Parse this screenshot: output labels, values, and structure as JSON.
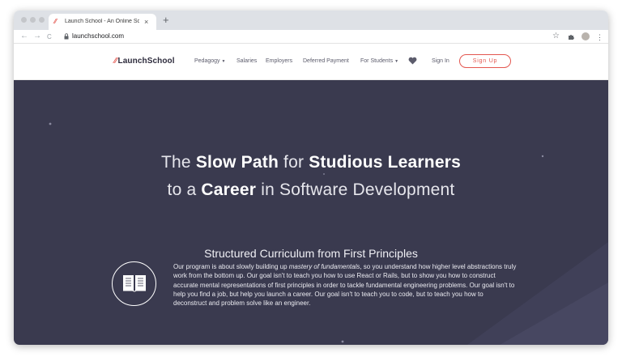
{
  "browser": {
    "tab_title": "Launch School - An Online Sc",
    "tab_close": "×",
    "new_tab": "+",
    "nav": {
      "back": "←",
      "forward": "→",
      "reload": "C"
    },
    "url": "launchschool.com",
    "toolbar_icons": [
      "star-icon",
      "puzzle-icon",
      "avatar",
      "menu-icon"
    ]
  },
  "site": {
    "logo": "LaunchSchool",
    "logo_mark": "⁄⁄",
    "nav": [
      {
        "label": "Pedagogy",
        "has_caret": true
      },
      {
        "label": "Salaries",
        "has_caret": false
      },
      {
        "label": "Employers",
        "has_caret": false
      },
      {
        "label": "Deferred Payment",
        "has_caret": false
      },
      {
        "label": "For Students",
        "has_caret": true
      }
    ],
    "caret": "▼",
    "signin": "Sign In",
    "signup": "Sign Up"
  },
  "hero": {
    "line1": {
      "p1": "The ",
      "b1": "Slow Path",
      "p2": " for ",
      "b2": "Studious Learners"
    },
    "line2": {
      "p1": "to a ",
      "b1": "Career",
      "p2": " in Software Development"
    },
    "subheading": "Structured Curriculum from First Principles",
    "para": {
      "p1": "Our program is about slowly building up ",
      "em": "mastery of fundamentals",
      "p2": ", so you understand how higher level abstractions truly work from the bottom up. Our goal isn't to teach you how to use React or Rails, but to show you how to construct accurate mental representations of first principles in order to tackle fundamental engineering problems. Our goal isn't to help you find a job, but help you launch a career. Our goal isn't to teach you to code, but to teach you how to deconstruct and problem solve like an engineer."
    }
  },
  "colors": {
    "accent": "#e3564f",
    "hero_bg": "#3a3a4f",
    "chrome": "#dee1e6"
  }
}
